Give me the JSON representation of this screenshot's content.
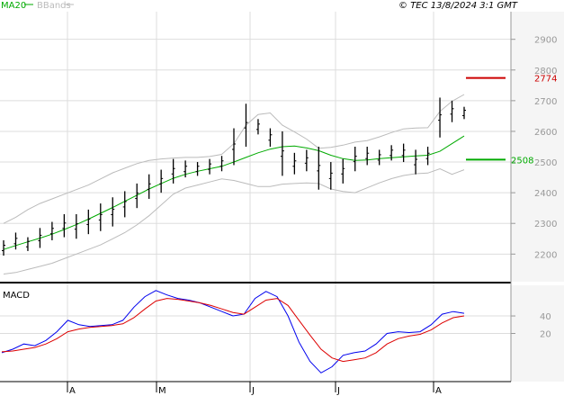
{
  "header": {
    "ma_label": "MA20",
    "bbands_label": "BBands",
    "copyright": "© TEC 13/8/2024 3:1 GMT"
  },
  "colors": {
    "ma": "#00aa00",
    "bbands": "#bbbbbb",
    "price": "#000000",
    "resistance": "#cc0000",
    "support": "#00aa00",
    "macd": "#0000ee",
    "signal": "#dd0000",
    "grid": "#dddddd",
    "panel_bg": "#f5f5f5"
  },
  "chart_data": [
    {
      "type": "bar",
      "subtype": "ohlc-price",
      "y_ticks": [
        "2900",
        "2800",
        "2700",
        "2600",
        "2500",
        "2400",
        "2300",
        "2200"
      ],
      "ylim": [
        2110,
        2990
      ],
      "month_labels": [
        "A",
        "M",
        "J",
        "J",
        "A"
      ],
      "series": [
        {
          "name": "MA20",
          "values": [
            2215,
            2228,
            2240,
            2252,
            2265,
            2280,
            2296,
            2314,
            2333,
            2352,
            2372,
            2392,
            2412,
            2430,
            2447,
            2460,
            2470,
            2478,
            2486,
            2500,
            2515,
            2530,
            2542,
            2550,
            2552,
            2546,
            2537,
            2522,
            2511,
            2505,
            2507,
            2511,
            2514,
            2517,
            2520,
            2522,
            2535,
            2560,
            2585
          ]
        },
        {
          "name": "BBands",
          "values_upper": [
            2300,
            2320,
            2345,
            2365,
            2380,
            2395,
            2410,
            2425,
            2445,
            2465,
            2480,
            2495,
            2505,
            2510,
            2513,
            2515,
            2515,
            2518,
            2525,
            2560,
            2620,
            2655,
            2660,
            2620,
            2598,
            2575,
            2545,
            2548,
            2555,
            2565,
            2570,
            2582,
            2596,
            2608,
            2611,
            2612,
            2665,
            2698,
            2720
          ],
          "values_lower": [
            2135,
            2140,
            2150,
            2160,
            2170,
            2185,
            2200,
            2215,
            2230,
            2250,
            2270,
            2295,
            2325,
            2360,
            2395,
            2415,
            2425,
            2435,
            2445,
            2440,
            2430,
            2420,
            2420,
            2428,
            2430,
            2432,
            2430,
            2412,
            2404,
            2400,
            2416,
            2432,
            2446,
            2456,
            2462,
            2464,
            2478,
            2460,
            2475
          ]
        }
      ],
      "bars": [
        [
          2195,
          2245
        ],
        [
          2215,
          2270
        ],
        [
          2210,
          2255
        ],
        [
          2220,
          2285
        ],
        [
          2245,
          2305
        ],
        [
          2255,
          2330
        ],
        [
          2250,
          2330
        ],
        [
          2265,
          2345
        ],
        [
          2275,
          2365
        ],
        [
          2290,
          2385
        ],
        [
          2320,
          2405
        ],
        [
          2350,
          2430
        ],
        [
          2380,
          2460
        ],
        [
          2400,
          2475
        ],
        [
          2430,
          2510
        ],
        [
          2450,
          2505
        ],
        [
          2455,
          2500
        ],
        [
          2460,
          2510
        ],
        [
          2470,
          2520
        ],
        [
          2490,
          2610
        ],
        [
          2550,
          2690
        ],
        [
          2590,
          2640
        ],
        [
          2550,
          2610
        ],
        [
          2455,
          2600
        ],
        [
          2460,
          2530
        ],
        [
          2470,
          2540
        ],
        [
          2410,
          2550
        ],
        [
          2410,
          2500
        ],
        [
          2430,
          2510
        ],
        [
          2470,
          2550
        ],
        [
          2490,
          2550
        ],
        [
          2490,
          2540
        ],
        [
          2505,
          2555
        ],
        [
          2500,
          2560
        ],
        [
          2460,
          2540
        ],
        [
          2490,
          2550
        ],
        [
          2580,
          2710
        ],
        [
          2630,
          2700
        ],
        [
          2640,
          2680
        ]
      ],
      "levels": [
        {
          "label": "2774",
          "value": 2774,
          "color": "#cc0000"
        },
        {
          "label": "2508",
          "value": 2508,
          "color": "#00aa00"
        }
      ]
    },
    {
      "type": "line",
      "subtype": "macd",
      "title": "MACD",
      "y_ticks": [
        "40",
        "20"
      ],
      "ylim": [
        -35,
        75
      ],
      "series": [
        {
          "name": "MACD",
          "values": [
            -2,
            2,
            8,
            6,
            12,
            22,
            35,
            30,
            28,
            29,
            30,
            35,
            50,
            62,
            69,
            64,
            60,
            58,
            55,
            50,
            45,
            40,
            42,
            60,
            68,
            62,
            40,
            10,
            -12,
            -25,
            -18,
            -5,
            -2,
            0,
            8,
            20,
            22,
            21,
            22,
            30,
            42,
            45,
            43
          ]
        },
        {
          "name": "Signal",
          "values": [
            -1,
            0,
            2,
            4,
            8,
            14,
            22,
            25,
            27,
            28,
            29,
            31,
            38,
            48,
            57,
            60,
            59,
            57,
            55,
            52,
            48,
            44,
            42,
            50,
            58,
            60,
            52,
            35,
            18,
            2,
            -8,
            -12,
            -10,
            -8,
            -2,
            8,
            14,
            17,
            19,
            24,
            32,
            38,
            40
          ]
        }
      ]
    }
  ]
}
